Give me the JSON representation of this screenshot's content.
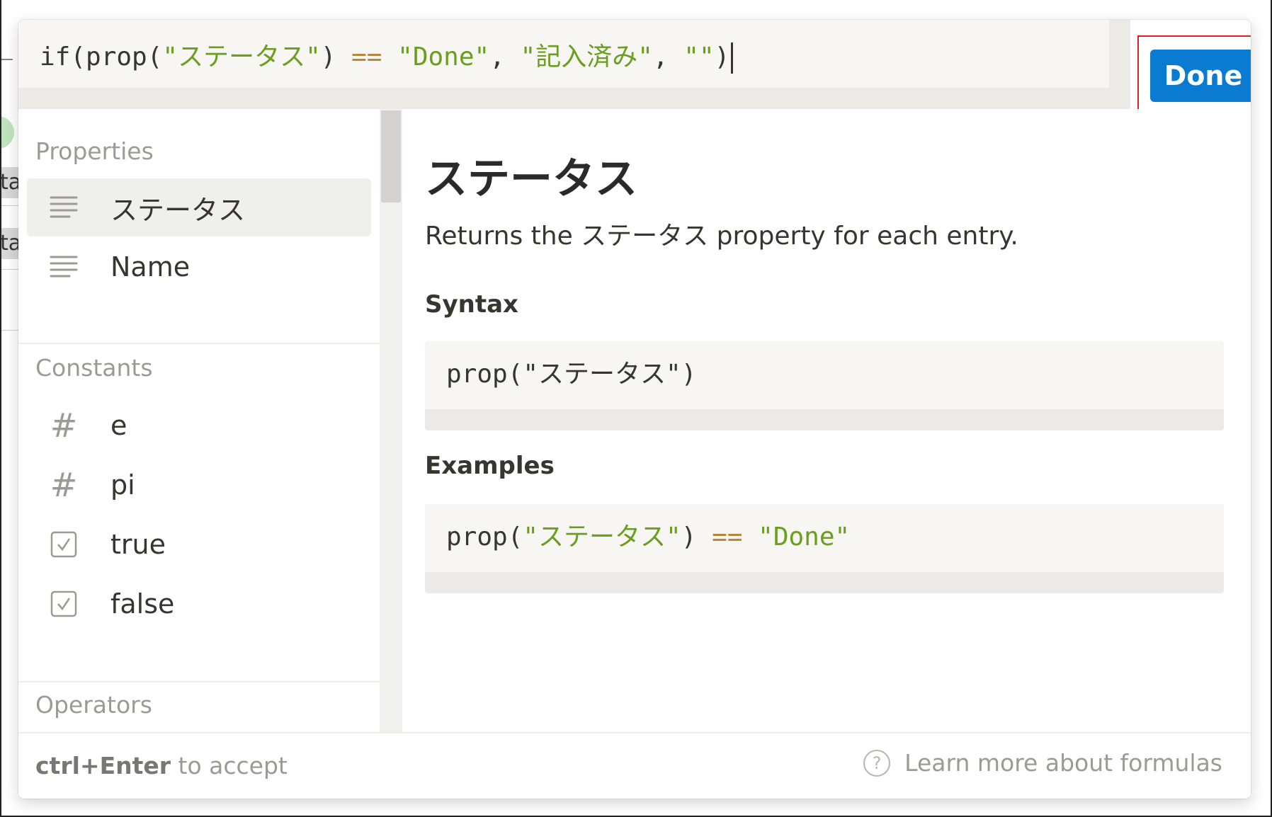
{
  "background": {
    "page_heading": "",
    "row_fragments": [
      "ta",
      "ta"
    ]
  },
  "editor": {
    "formula_tokens": [
      {
        "text": "if(prop(",
        "kind": "plain"
      },
      {
        "text": "\"ステータス\"",
        "kind": "string"
      },
      {
        "text": ") ",
        "kind": "plain"
      },
      {
        "text": "==",
        "kind": "op"
      },
      {
        "text": " ",
        "kind": "plain"
      },
      {
        "text": "\"Done\"",
        "kind": "string"
      },
      {
        "text": ", ",
        "kind": "plain"
      },
      {
        "text": "\"記入済み\"",
        "kind": "string"
      },
      {
        "text": ", ",
        "kind": "plain"
      },
      {
        "text": "\"\"",
        "kind": "string"
      },
      {
        "text": ")",
        "kind": "plain"
      }
    ],
    "done_label": "Done"
  },
  "sidebar": {
    "sections": [
      {
        "label": "Properties",
        "items": [
          {
            "label": "ステータス",
            "icon": "text-lines-icon",
            "selected": true
          },
          {
            "label": "Name",
            "icon": "text-lines-icon",
            "selected": false
          }
        ]
      },
      {
        "label": "Constants",
        "items": [
          {
            "label": "e",
            "icon": "hash-icon",
            "selected": false
          },
          {
            "label": "pi",
            "icon": "hash-icon",
            "selected": false
          },
          {
            "label": "true",
            "icon": "checkbox-icon",
            "selected": false
          },
          {
            "label": "false",
            "icon": "checkbox-icon",
            "selected": false
          }
        ]
      },
      {
        "label": "Operators",
        "items": []
      }
    ]
  },
  "detail": {
    "title": "ステータス",
    "description": "Returns the ステータス property for each entry.",
    "syntax_heading": "Syntax",
    "syntax_code": "prop(\"ステータス\")",
    "examples_heading": "Examples",
    "example_tokens": [
      {
        "text": "prop(",
        "kind": "plain"
      },
      {
        "text": "\"ステータス\"",
        "kind": "string"
      },
      {
        "text": ") ",
        "kind": "plain"
      },
      {
        "text": "==",
        "kind": "op"
      },
      {
        "text": " ",
        "kind": "plain"
      },
      {
        "text": "\"Done\"",
        "kind": "string"
      }
    ]
  },
  "footer": {
    "shortcut": "ctrl+Enter",
    "shortcut_suffix": " to accept",
    "help_icon_glyph": "?",
    "learn_more": "Learn more about formulas"
  },
  "colors": {
    "accent": "#0b7ad1",
    "string_token": "#6a9e1f",
    "operator_token": "#b8863d",
    "highlight_outline": "#e02020"
  }
}
